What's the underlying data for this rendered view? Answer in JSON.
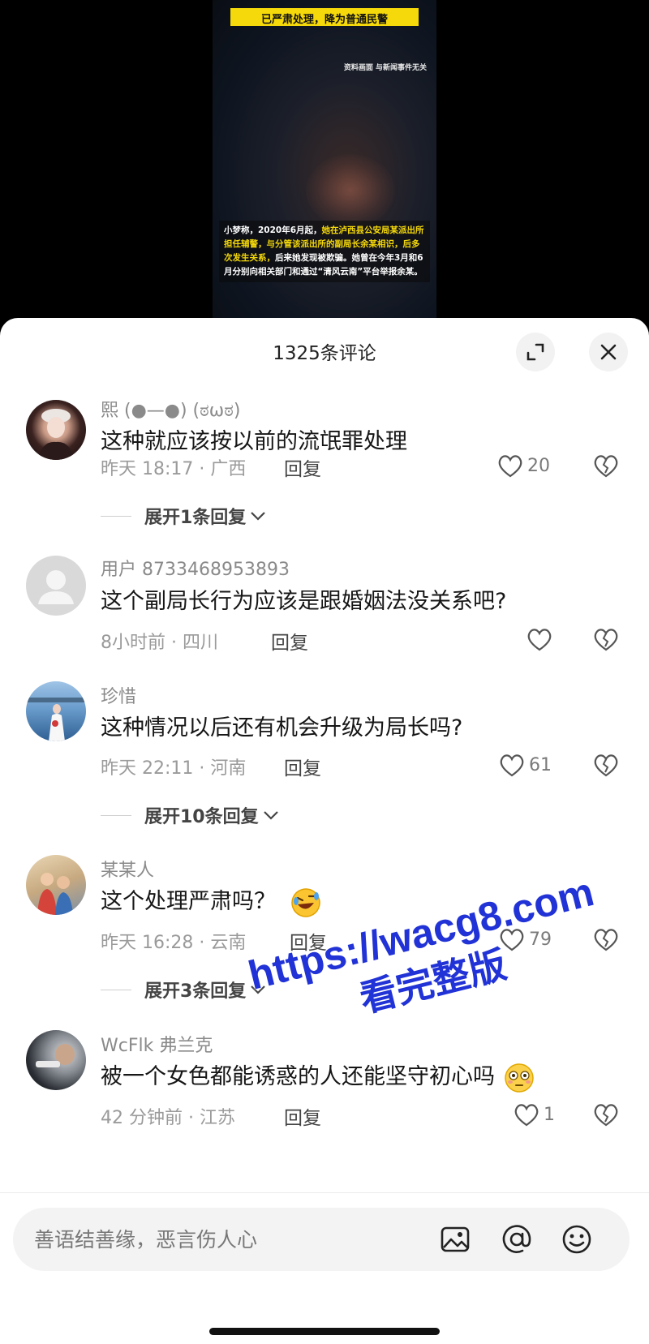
{
  "video": {
    "top_caption": "已严肃处理，降为普通民警",
    "note": "资料画面 与新闻事件无关",
    "caption_plain_1": "小梦称，2020年6月起，",
    "caption_hl_1": "她在泸西县公安局某派出所担任辅警，与分管该派出所的副局长余某相识，后多次发生关系，",
    "caption_plain_2": "后来她发现被欺骗。她曾在今年3月和6月分别向相关部门和通过“清风云南”平台举报余某。"
  },
  "header": {
    "title": "1325条评论"
  },
  "comments": [
    {
      "username": "熙 (●—●) (ಠωಠ)",
      "content": "这种就应该按以前的流氓罪处理",
      "meta": "昨天 18:17 · 广西",
      "reply": "回复",
      "likes": "20",
      "expand": "展开1条回复"
    },
    {
      "username": "用户 8733468953893",
      "content": "这个副局长行为应该是跟婚姻法没关系吧?",
      "meta": "8小时前 · 四川",
      "reply": "回复",
      "likes": ""
    },
    {
      "username": "珍惜",
      "content": "这种情况以后还有机会升级为局长吗?",
      "meta": "昨天 22:11 · 河南",
      "reply": "回复",
      "likes": "61",
      "expand": "展开10条回复"
    },
    {
      "username": "某某人",
      "content": "这个处理严肃吗？",
      "meta": "昨天 16:28 · 云南",
      "reply": "回复",
      "likes": "79",
      "expand": "展开3条回复"
    },
    {
      "username": "WcFlk 弗兰克",
      "content": "被一个女色都能诱惑的人还能坚守初心吗",
      "meta": "42 分钟前 · 江苏",
      "reply": "回复",
      "likes": "1"
    }
  ],
  "watermark": {
    "url": "https://wacg8.com",
    "sub": "看完整版"
  },
  "input": {
    "placeholder": "善语结善缘，恶言伤人心"
  },
  "icons": {
    "expand": "expand-icon",
    "close": "close-icon",
    "like": "heart-icon",
    "dislike": "broken-heart-icon",
    "image": "image-icon",
    "mention": "at-icon",
    "emoji": "smiley-icon"
  },
  "colors": {
    "highlight_yellow": "#f5d90a",
    "watermark_blue": "#2133d6",
    "meta_gray": "#9a9a9a"
  }
}
